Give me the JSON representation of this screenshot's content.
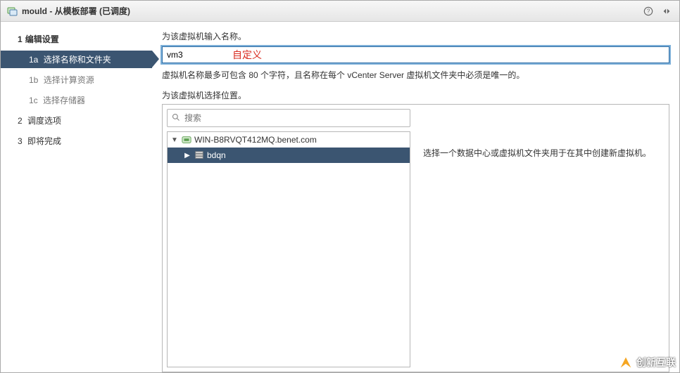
{
  "titlebar": {
    "title": "mould - 从模板部署 (已调度)"
  },
  "sidebar": {
    "step1": {
      "num": "1",
      "label": "编辑设置"
    },
    "step1a": {
      "num": "1a",
      "label": "选择名称和文件夹"
    },
    "step1b": {
      "num": "1b",
      "label": "选择计算资源"
    },
    "step1c": {
      "num": "1c",
      "label": "选择存储器"
    },
    "step2": {
      "num": "2",
      "label": "调度选项"
    },
    "step3": {
      "num": "3",
      "label": "即将完成"
    }
  },
  "main": {
    "name_label": "为该虚拟机输入名称。",
    "vm_name_value": "vm3",
    "annotation": "自定义",
    "name_hint": "虚拟机名称最多可包含 80 个字符，且名称在每个 vCenter Server 虚拟机文件夹中必须是唯一的。",
    "location_label": "为该虚拟机选择位置。",
    "search_placeholder": "搜索",
    "tree": {
      "root_label": "WIN-B8RVQT412MQ.benet.com",
      "child_label": "bdqn"
    },
    "right_hint": "选择一个数据中心或虚拟机文件夹用于在其中创建新虚拟机。"
  },
  "watermark": {
    "text": "创新互联"
  }
}
